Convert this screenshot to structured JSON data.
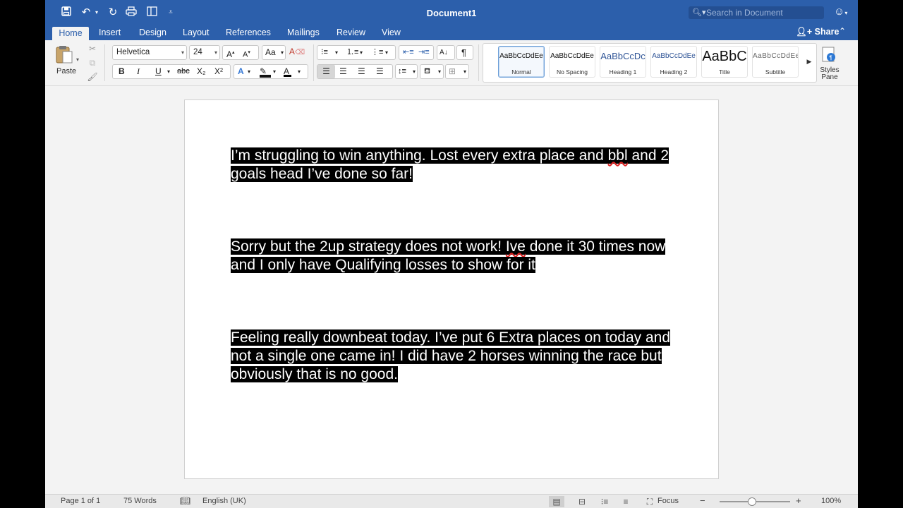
{
  "title_bar": {
    "doc_title": "Document1",
    "search_placeholder": "Search in Document"
  },
  "tabs": [
    {
      "label": "Home",
      "active": true
    },
    {
      "label": "Insert"
    },
    {
      "label": "Design"
    },
    {
      "label": "Layout"
    },
    {
      "label": "References"
    },
    {
      "label": "Mailings"
    },
    {
      "label": "Review"
    },
    {
      "label": "View"
    }
  ],
  "share_label": "Share",
  "ribbon": {
    "paste_label": "Paste",
    "font_name": "Helvetica",
    "font_size": "24",
    "bold": "B",
    "italic": "I",
    "underline": "U",
    "strike": "abc",
    "subscript": "X₂",
    "superscript": "X²",
    "styles": [
      {
        "sample": "AaBbCcDdEe",
        "name": "Normal",
        "selected": true
      },
      {
        "sample": "AaBbCcDdEe",
        "name": "No Spacing"
      },
      {
        "sample": "AaBbCcDc",
        "name": "Heading 1"
      },
      {
        "sample": "AaBbCcDdEe",
        "name": "Heading 2"
      },
      {
        "sample": "AaBbC",
        "name": "Title"
      },
      {
        "sample": "AaBbCcDdEe",
        "name": "Subtitle"
      }
    ],
    "styles_pane_line1": "Styles",
    "styles_pane_line2": "Pane"
  },
  "document": {
    "paragraphs": [
      {
        "before": "I’m struggling to win anything. Lost every extra place and ",
        "misspelled": "bbl",
        "after": " and 2 goals head I’ve done so far!"
      },
      {
        "before": "Sorry but the 2up strategy does not work! ",
        "misspelled": "Ive",
        "after": " done it 30 times now and I only have Qualifying losses to show for it "
      },
      {
        "before": "Feeling really downbeat today. I’ve put 6 Extra places on today and not a single one came in! I did have 2 horses winning the race but obviously that is no good.",
        "misspelled": "",
        "after": ""
      }
    ]
  },
  "status_bar": {
    "page": "Page 1 of 1",
    "words": "75 Words",
    "language": "English (UK)",
    "focus": "Focus",
    "zoom": "100%",
    "zoom_minus": "−",
    "zoom_plus": "+"
  },
  "colors": {
    "titlebar": "#2c5fab",
    "highlight": "#000000",
    "text": "#ffffff"
  }
}
